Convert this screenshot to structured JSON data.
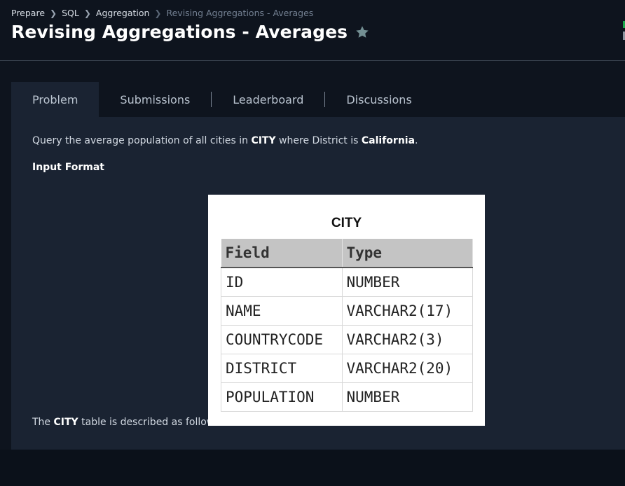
{
  "breadcrumb": {
    "items": [
      "Prepare",
      "SQL",
      "Aggregation"
    ],
    "current": "Revising Aggregations - Averages"
  },
  "page": {
    "title": "Revising Aggregations - Averages"
  },
  "tabs": [
    {
      "label": "Problem",
      "active": true
    },
    {
      "label": "Submissions",
      "active": false
    },
    {
      "label": "Leaderboard",
      "active": false
    },
    {
      "label": "Discussions",
      "active": false
    }
  ],
  "problem": {
    "desc_prefix": "Query the average population of all cities in ",
    "desc_table": "CITY",
    "desc_middle": " where District is ",
    "desc_value": "California",
    "desc_suffix": ".",
    "input_format_label": "Input Format",
    "table_desc_prefix": "The ",
    "table_desc_table": "CITY",
    "table_desc_suffix": " table is described as follows:"
  },
  "schema_image": {
    "title": "CITY",
    "headers": [
      "Field",
      "Type"
    ],
    "rows": [
      [
        "ID",
        "NUMBER"
      ],
      [
        "NAME",
        "VARCHAR2(17)"
      ],
      [
        "COUNTRYCODE",
        "VARCHAR2(3)"
      ],
      [
        "DISTRICT",
        "VARCHAR2(20)"
      ],
      [
        "POPULATION",
        "NUMBER"
      ]
    ]
  },
  "icons": {
    "star": "star-icon",
    "chevron": "chevron-right-icon"
  },
  "colors": {
    "background": "#0e141e",
    "panel": "#1a2332",
    "star": "#738f93",
    "accent": "#1ba94c"
  }
}
